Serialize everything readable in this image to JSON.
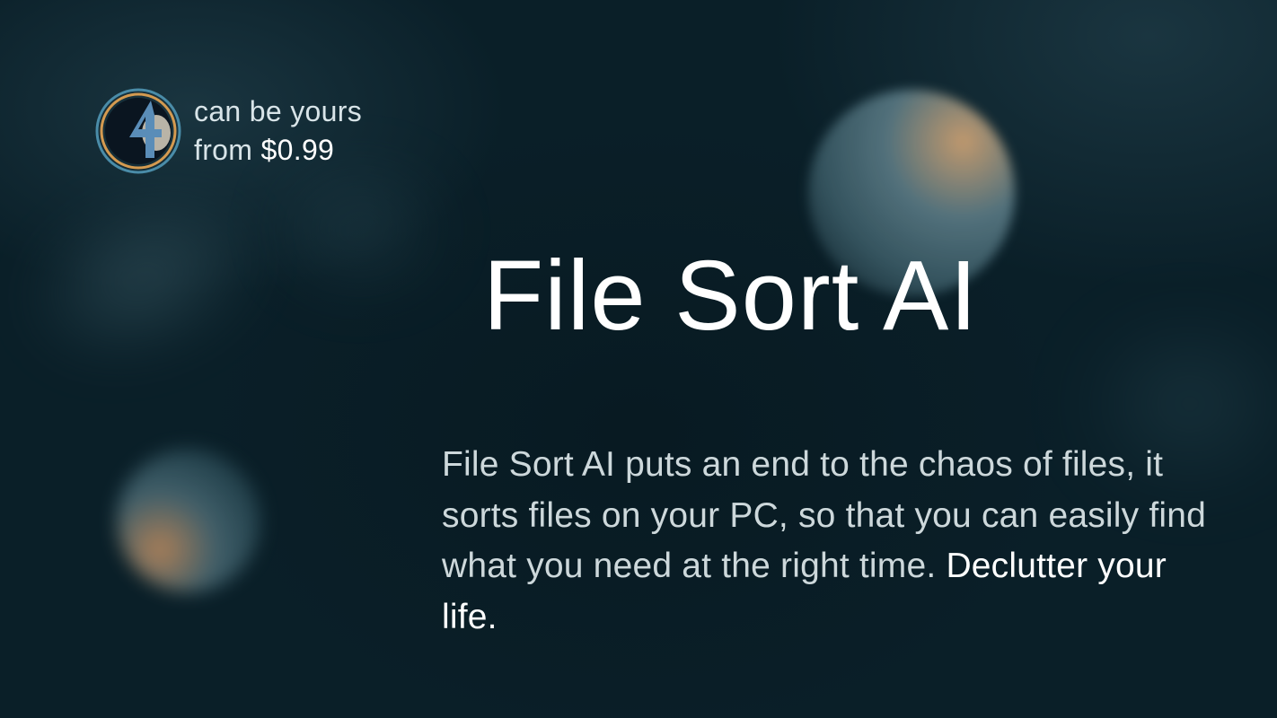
{
  "badge": {
    "line1": "can be yours",
    "line2_prefix": "from ",
    "price": "$0.99"
  },
  "title": "File Sort AI",
  "description": {
    "main": "File Sort AI puts an end to the chaos of files, it sorts files on your PC, so that you can easily find what you need at the right time. ",
    "strong": "Declutter your life."
  }
}
